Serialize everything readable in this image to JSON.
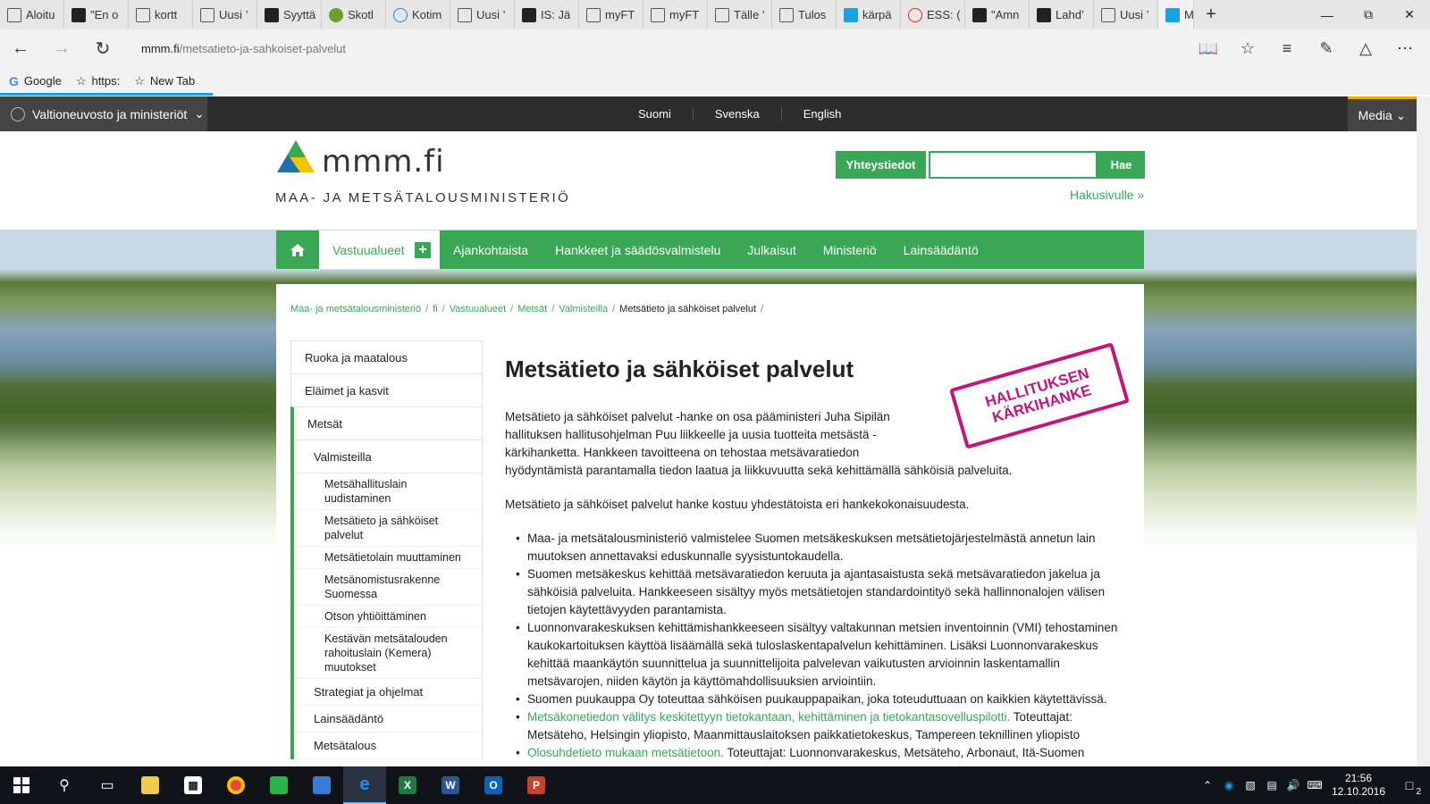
{
  "browser": {
    "tabs": [
      {
        "title": "Aloitu",
        "icon": "page-icon"
      },
      {
        "title": "\"En o",
        "icon": "dark-logo-icon"
      },
      {
        "title": "kortt",
        "icon": "page-icon"
      },
      {
        "title": "Uusi ’",
        "icon": "page-icon"
      },
      {
        "title": "Syyttä",
        "icon": "dark-logo-icon"
      },
      {
        "title": "Skotl",
        "icon": "green-shield-icon"
      },
      {
        "title": "Kotim",
        "icon": "ring-icon"
      },
      {
        "title": "Uusi ’",
        "icon": "page-icon"
      },
      {
        "title": "IS: Jä",
        "icon": "dark-logo-icon"
      },
      {
        "title": "myFT",
        "icon": "page-icon"
      },
      {
        "title": "myFT",
        "icon": "page-icon"
      },
      {
        "title": "Tälle ’",
        "icon": "page-icon"
      },
      {
        "title": "Tulos",
        "icon": "page-icon"
      },
      {
        "title": "kärpä",
        "icon": "blue-b-icon"
      },
      {
        "title": "ESS: (",
        "icon": "red-circle-icon"
      },
      {
        "title": "\"Amn",
        "icon": "dark-logo-icon"
      },
      {
        "title": "Lahd’",
        "icon": "v-logo-icon"
      },
      {
        "title": "Uusi ’",
        "icon": "page-icon"
      }
    ],
    "active_tab": {
      "title": "M",
      "icon": "blue-site-icon"
    },
    "url_host": "mmm.fi",
    "url_path": "/metsatieto-ja-sahkoiset-palvelut",
    "favorites": [
      {
        "label": "Google",
        "icon": "google-icon"
      },
      {
        "label": "https:",
        "icon": "star-icon"
      },
      {
        "label": "New Tab",
        "icon": "star-icon"
      }
    ]
  },
  "site": {
    "gov_label": "Valtioneuvosto ja ministeriöt",
    "languages": [
      "Suomi",
      "Svenska",
      "English"
    ],
    "media_label": "Media",
    "logo_word": "mmm.fi",
    "logo_sub": "MAA- JA METSÄTALOUSMINISTERIÖ",
    "contact_label": "Yhteystiedot",
    "search_button": "Hae",
    "search_page_link": "Hakusivulle »",
    "nav": [
      "Vastuualueet",
      "Ajankohtaista",
      "Hankkeet ja säädösvalmistelu",
      "Julkaisut",
      "Ministeriö",
      "Lainsäädäntö"
    ],
    "breadcrumb": [
      "Maa- ja metsätalousministeriö",
      "fi",
      "Vastuualueet",
      "Metsät",
      "Valmisteilla"
    ],
    "breadcrumb_current": "Metsätieto ja sähköiset palvelut",
    "sidebar": {
      "top": [
        "Ruoka ja maatalous",
        "Eläimet ja kasvit"
      ],
      "active": "Metsät",
      "level2": "Valmisteilla",
      "level3": [
        "Metsähallituslain uudistaminen",
        "Metsätieto ja sähköiset palvelut",
        "Metsätietolain muuttaminen",
        "Metsänomistusrakenne Suomessa",
        "Otson yhtiöittäminen",
        "Kestävän metsätalouden rahoituslain (Kemera) muutokset"
      ],
      "level2_more": [
        "Strategiat ja ohjelmat",
        "Lainsäädäntö",
        "Metsätalous"
      ]
    },
    "article": {
      "title": "Metsätieto ja sähköiset palvelut",
      "stamp_line1": "HALLITUKSEN",
      "stamp_line2": "KÄRKIHANKE",
      "intro_a": "Metsätieto ja sähköiset palvelut -hanke on osa pääministeri Juha Sipilän hallituksen hallitusohjelman Puu liikkeelle ja uusia tuotteita metsästä -kärkihanketta. Hankkeen tavoitteena on tehostaa metsävaratiedon",
      "intro_b": "hyödyntämistä parantamalla tiedon laatua ja liikkuvuutta sekä kehittämällä sähköisiä palveluita.",
      "para2": "Metsätieto ja sähköiset palvelut hanke kostuu yhdestätoista eri hankekokonaisuudesta.",
      "bullets": [
        {
          "text": "Maa- ja metsätalousministeriö valmistelee Suomen metsäkeskuksen metsätietojärjestelmästä annetun lain muutoksen annettavaksi eduskunnalle syysistuntokaudella."
        },
        {
          "text": "Suomen metsäkeskus kehittää metsävaratiedon keruuta ja ajantasaistusta sekä metsävaratiedon jakelua ja sähköisiä palveluita. Hankkeeseen sisältyy myös metsätietojen standardointityö sekä hallinnonalojen välisen tietojen käytettävyyden parantamista."
        },
        {
          "text": "Luonnonvarakeskuksen kehittämishankkeeseen sisältyy valtakunnan metsien inventoinnin (VMI) tehostaminen kaukokartoituksen käyttöä lisäämällä sekä tuloslaskentapalvelun kehittäminen. Lisäksi Luonnonvarakeskus kehittää maankäytön suunnittelua ja suunnittelijoita palvelevan vaikutusten arvioinnin laskentamallin metsävarojen, niiden käytön ja käyttömahdollisuuksien arviointiin."
        },
        {
          "text": "Suomen puukauppa Oy toteuttaa sähköisen puukauppapaikan, joka toteuduttuaan on kaikkien käytettävissä."
        },
        {
          "link": "Metsäkonetiedon välitys keskitettyyn tietokantaan, kehittäminen ja tietokantasovelluspilotti.",
          "text": " Toteuttajat: Metsäteho, Helsingin yliopisto, Maanmittauslaitoksen paikkatietokeskus, Tampereen teknillinen yliopisto"
        },
        {
          "link": "Olosuhdetieto mukaan metsätietoon.",
          "text": " Toteuttajat: Luonnonvarakeskus, Metsäteho, Arbonaut, Itä-Suomen"
        }
      ]
    }
  },
  "taskbar": {
    "apps": [
      "search-icon",
      "task-view-icon",
      "file-explorer-icon",
      "store-icon",
      "chrome-icon",
      "app-green-icon",
      "remote-desktop-icon",
      "edge-icon",
      "excel-icon",
      "word-icon",
      "outlook-icon",
      "powerpoint-icon"
    ],
    "time": "21:56",
    "date": "12.10.2016",
    "notification_count": "2"
  },
  "colors": {
    "accent_green": "#3aa757",
    "stamp_magenta": "#c4157a",
    "gov_bar": "#2d2d2d"
  }
}
